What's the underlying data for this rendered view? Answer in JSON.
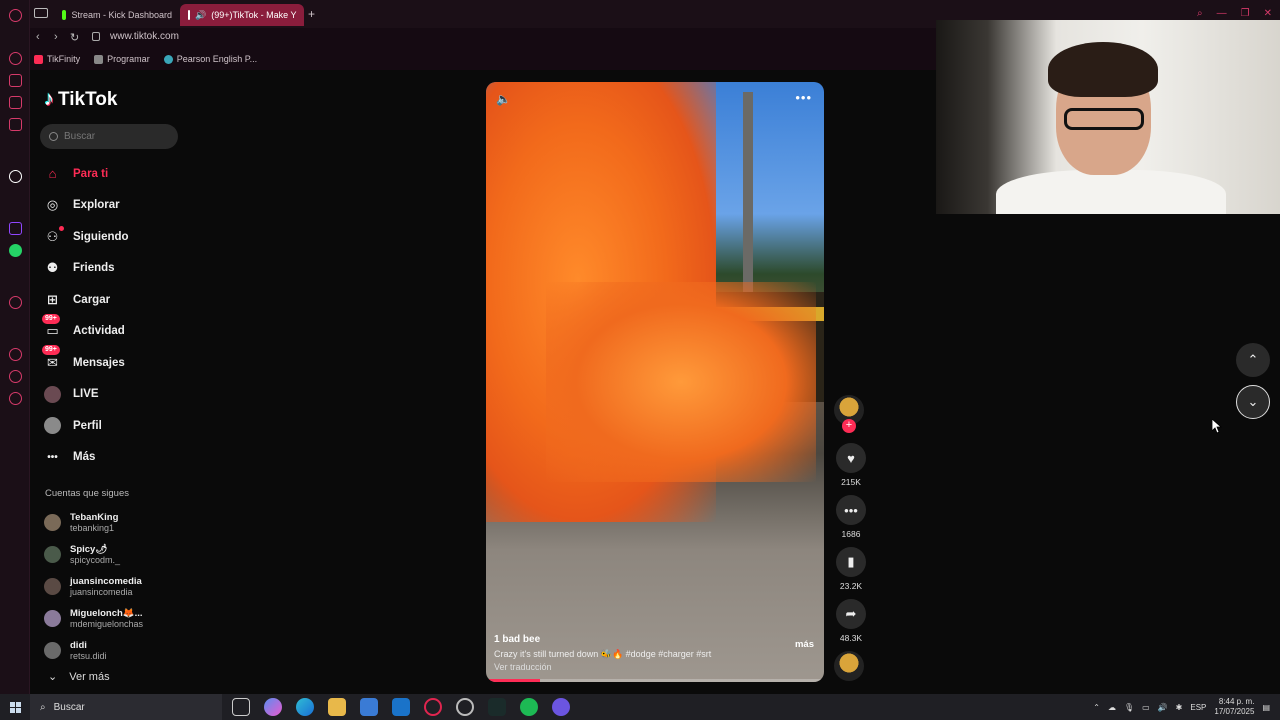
{
  "browser": {
    "tabs": [
      {
        "label": "Stream - Kick Dashboard",
        "fav_color": "#53fc18"
      },
      {
        "label": "(99+)TikTok - Make Y",
        "fav_color": "#000000"
      }
    ],
    "url": "www.tiktok.com",
    "bookmarks": [
      "TikFinity",
      "Programar",
      "Pearson English P..."
    ]
  },
  "tiktok": {
    "logo": "TikTok",
    "search_placeholder": "Buscar",
    "nav": [
      {
        "label": "Para ti",
        "icon": "home-icon",
        "glyph": "⌂"
      },
      {
        "label": "Explorar",
        "icon": "compass-icon",
        "glyph": "◎"
      },
      {
        "label": "Siguiendo",
        "icon": "following-icon",
        "glyph": "👤"
      },
      {
        "label": "Friends",
        "icon": "friends-icon",
        "glyph": "👥"
      },
      {
        "label": "Cargar",
        "icon": "upload-icon",
        "glyph": "⊞"
      },
      {
        "label": "Actividad",
        "icon": "activity-icon",
        "glyph": "◻",
        "badge": "99+"
      },
      {
        "label": "Mensajes",
        "icon": "messages-icon",
        "glyph": "✉",
        "badge": "99+"
      },
      {
        "label": "LIVE",
        "icon": "live-icon",
        "glyph": "●"
      },
      {
        "label": "Perfil",
        "icon": "profile-icon",
        "glyph": "●"
      },
      {
        "label": "Más",
        "icon": "more-icon",
        "glyph": "•••"
      }
    ],
    "following_title": "Cuentas que sigues",
    "following": [
      {
        "name": "TebanKing",
        "handle": "tebanking1"
      },
      {
        "name": "Spicy🌶",
        "handle": "spicycodm._"
      },
      {
        "name": "juansincomedia",
        "handle": "juansincomedia"
      },
      {
        "name": "Miguelonch🦊...",
        "handle": "mdemiguelonchas"
      },
      {
        "name": "didi",
        "handle": "retsu.didi"
      }
    ],
    "see_more": "Ver más"
  },
  "video": {
    "username": "1 bad bee",
    "caption": "Crazy it's still turned down 🐝🔥 #dodge #charger #srt",
    "caption_sub": "Ver traducción",
    "more_label": "más",
    "progress": 0.16,
    "likes": "215K",
    "comments": "1686",
    "saves": "23.2K",
    "shares": "48.3K"
  },
  "taskbar": {
    "search_label": "Buscar",
    "lang": "ESP",
    "time": "8:44 p. m.",
    "date": "17/07/2025"
  }
}
